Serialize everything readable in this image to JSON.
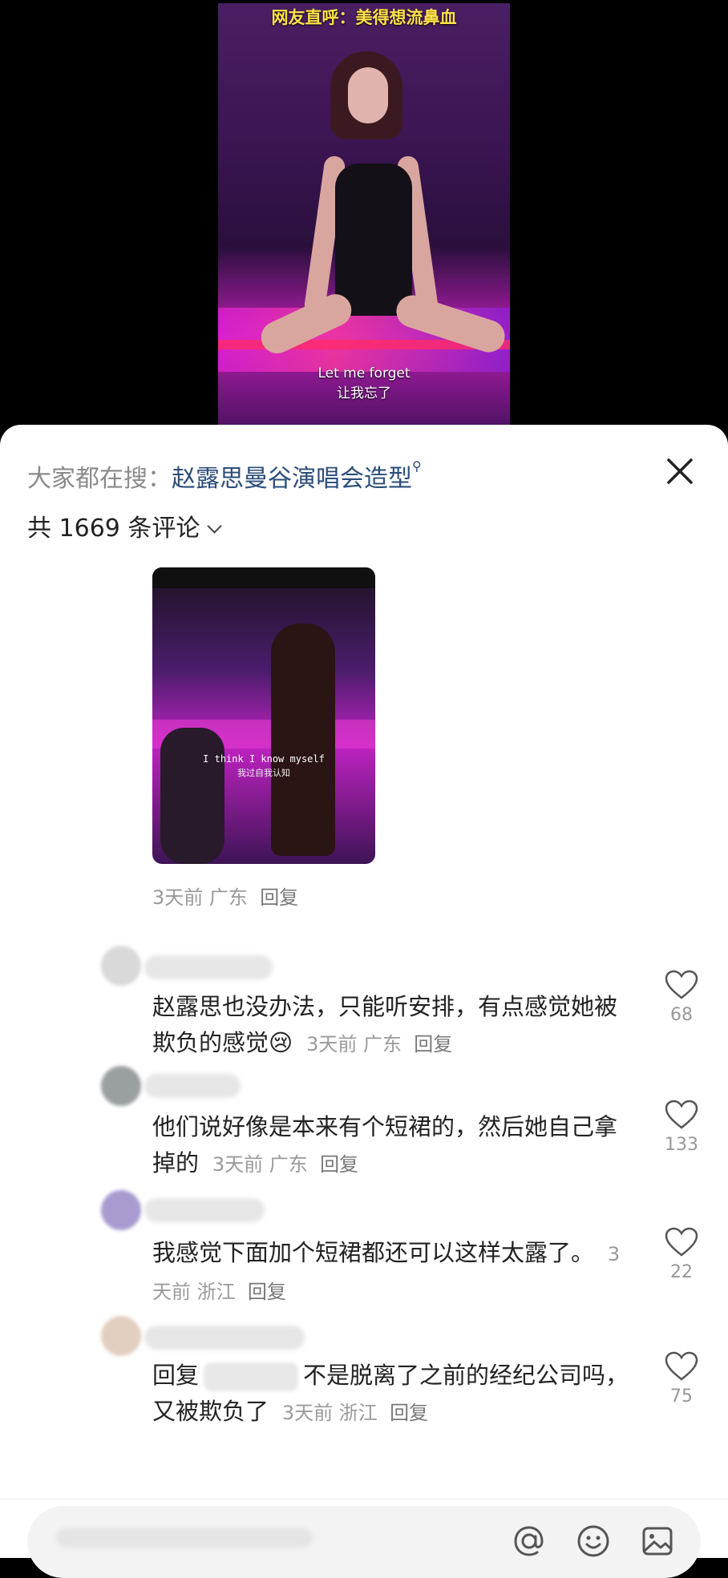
{
  "video": {
    "title": "网友直呼：美得想流鼻血",
    "subtitle_en": "Let me forget",
    "subtitle_zh": "让我忘了"
  },
  "panel": {
    "search_hint": "大家都在搜：",
    "search_term": "赵露思曼谷演唱会造型",
    "count_label": "共 1669 条评论"
  },
  "top_comment": {
    "image_caption_en": "I think I know myself",
    "image_caption_zh": "我过自我认知",
    "time": "3天前",
    "location": "广东",
    "reply_label": "回复"
  },
  "comments": [
    {
      "text": "赵露思也没办法，只能听安排，有点感觉她被欺负的感觉",
      "emoji": "😢",
      "time": "3天前",
      "location": "广东",
      "reply_label": "回复",
      "likes": "68"
    },
    {
      "text": "他们说好像是本来有个短裙的，然后她自己拿掉的",
      "time": "3天前",
      "location": "广东",
      "reply_label": "回复",
      "likes": "133"
    },
    {
      "text": "我感觉下面加个短裙都还可以这样太露了。",
      "time": "3天前",
      "location": "浙江",
      "reply_label": "回复",
      "likes": "22"
    },
    {
      "text_prefix": "回复",
      "text": "不是脱离了之前的经纪公司吗，又被欺负了",
      "time": "3天前",
      "location": "浙江",
      "reply_label": "回复",
      "likes": "75"
    }
  ],
  "input_bar": {
    "icons": [
      "at-icon",
      "emoji-icon",
      "image-icon"
    ]
  }
}
